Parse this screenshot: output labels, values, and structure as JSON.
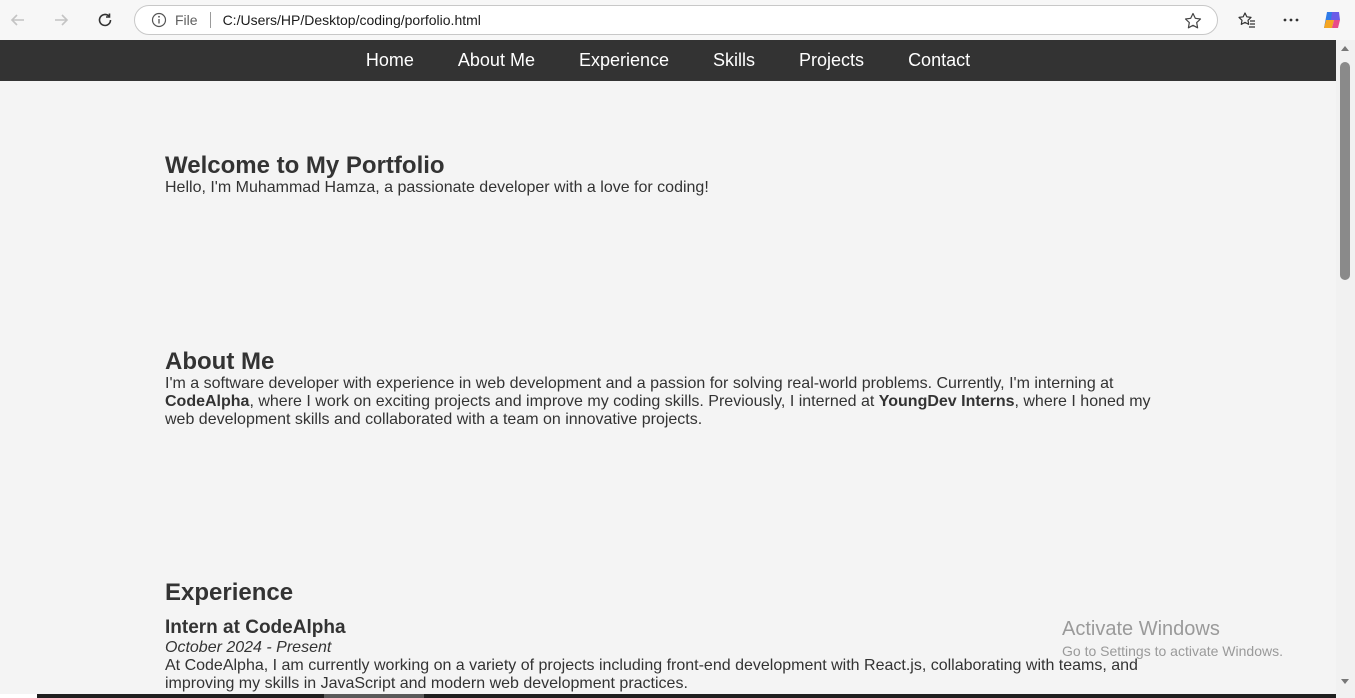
{
  "browser": {
    "scheme_label": "File",
    "url": "C:/Users/HP/Desktop/coding/porfolio.html"
  },
  "site_nav": {
    "items": [
      "Home",
      "About Me",
      "Experience",
      "Skills",
      "Projects",
      "Contact"
    ]
  },
  "hero": {
    "title": "Welcome to My Portfolio",
    "text": "Hello, I'm Muhammad Hamza, a passionate developer with a love for coding!"
  },
  "about": {
    "title": "About Me",
    "text_1": "I'm a software developer with experience in web development and a passion for solving real-world problems. Currently, I'm interning at ",
    "company_1": "CodeAlpha",
    "text_2": ", where I work on exciting projects and improve my coding skills. Previously, I interned at ",
    "company_2": "YoungDev Interns",
    "text_3": ", where I honed my web development skills and collaborated with a team on innovative projects."
  },
  "experience": {
    "title": "Experience",
    "job_title": "Intern at CodeAlpha",
    "job_date": "October 2024 - Present",
    "job_desc": "At CodeAlpha, I am currently working on a variety of projects including front-end development with React.js, collaborating with teams, and improving my skills in JavaScript and modern web development practices."
  },
  "watermark": {
    "line1": "Activate Windows",
    "line2": "Go to Settings to activate Windows."
  },
  "colors": {
    "nav_bg": "#333333",
    "page_bg": "#f4f4f4",
    "text": "#333333"
  }
}
